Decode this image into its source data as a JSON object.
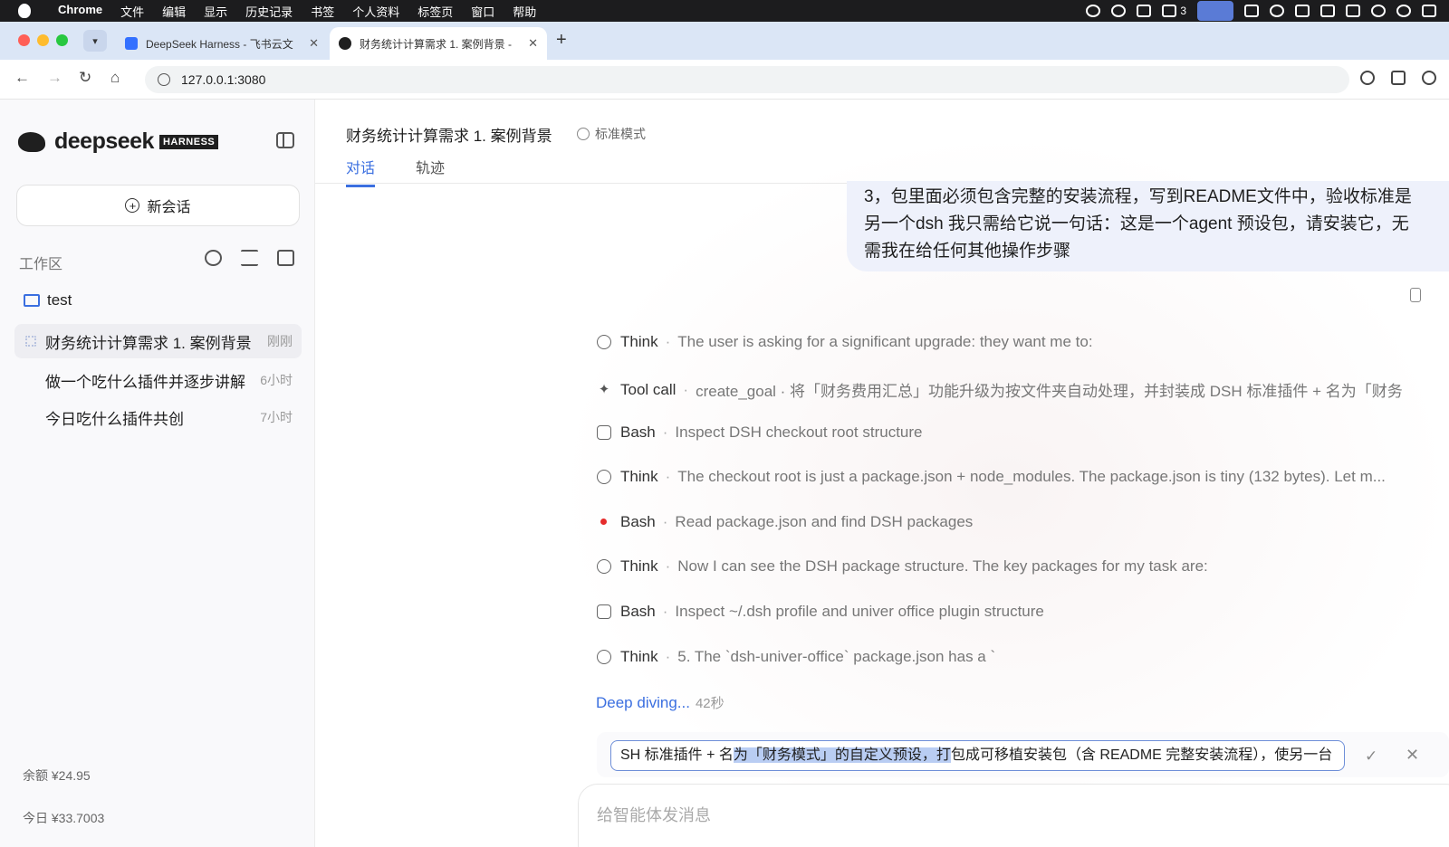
{
  "menubar": {
    "app": "Chrome",
    "items": [
      "文件",
      "编辑",
      "显示",
      "历史记录",
      "书签",
      "个人资料",
      "标签页",
      "窗口",
      "帮助"
    ],
    "status_count": "3"
  },
  "browser": {
    "tabs": [
      {
        "title": "DeepSeek Harness - 飞书云文",
        "close": "✕"
      },
      {
        "title": "财务统计计算需求 1. 案例背景 -",
        "close": "✕"
      }
    ],
    "new_tab": "+",
    "url": "127.0.0.1:3080"
  },
  "sidebar": {
    "brand": "deepseek",
    "badge": "HARNESS",
    "new_chat": "新会话",
    "workspace_label": "工作区",
    "folder": "test",
    "conversations": [
      {
        "title": "财务统计计算需求 1. 案例背景",
        "time": "刚刚"
      },
      {
        "title": "做一个吃什么插件并逐步讲解",
        "time": "6小时"
      },
      {
        "title": "今日吃什么插件共创",
        "time": "7小时"
      }
    ],
    "balance": "余额 ¥24.95",
    "today": "今日 ¥33.7003"
  },
  "main": {
    "title": "财务统计计算需求 1. 案例背景",
    "mode": "标准模式",
    "tabs": [
      "对话",
      "轨迹"
    ],
    "user_message": "3，包里面必须包含完整的安装流程，写到README文件中，验收标准是另一个dsh 我只需给它说一句话：这是一个agent 预设包，请安装它，无需我在给任何其他操作步骤",
    "steps": [
      {
        "icon": "think-icon",
        "kind": "Think",
        "detail": "The user is asking for a significant upgrade: they want me to:"
      },
      {
        "icon": "sparkle-icon",
        "kind": "Tool call",
        "detail": "create_goal · 将「财务费用汇总」功能升级为按文件夹自动处理，并封装成 DSH 标准插件 + 名为「财务"
      },
      {
        "icon": "terminal-icon",
        "kind": "Bash",
        "detail": "Inspect DSH checkout root structure"
      },
      {
        "icon": "think-icon",
        "kind": "Think",
        "detail": "The checkout root is just a package.json + node_modules. The package.json is tiny (132 bytes). Let m..."
      },
      {
        "icon": "running-dot-icon",
        "kind": "Bash",
        "detail": "Read package.json and find DSH packages"
      },
      {
        "icon": "think-icon",
        "kind": "Think",
        "detail": "Now I can see the DSH package structure. The key packages for my task are:"
      },
      {
        "icon": "terminal-icon",
        "kind": "Bash",
        "detail": "Inspect ~/.dsh profile and univer office plugin structure"
      },
      {
        "icon": "think-icon",
        "kind": "Think",
        "detail": "5. The `dsh-univer-office` package.json has a `"
      }
    ],
    "deep_diving": "Deep diving...",
    "deep_seconds": "42秒",
    "edit_before": "SH 标准插件 + 名",
    "edit_selected": "为「财务模式」的自定义预设，打",
    "edit_after": "包成可移植安装包（含 README 完整安装流程），使另一台",
    "composer_placeholder": "给智能体发消息"
  }
}
